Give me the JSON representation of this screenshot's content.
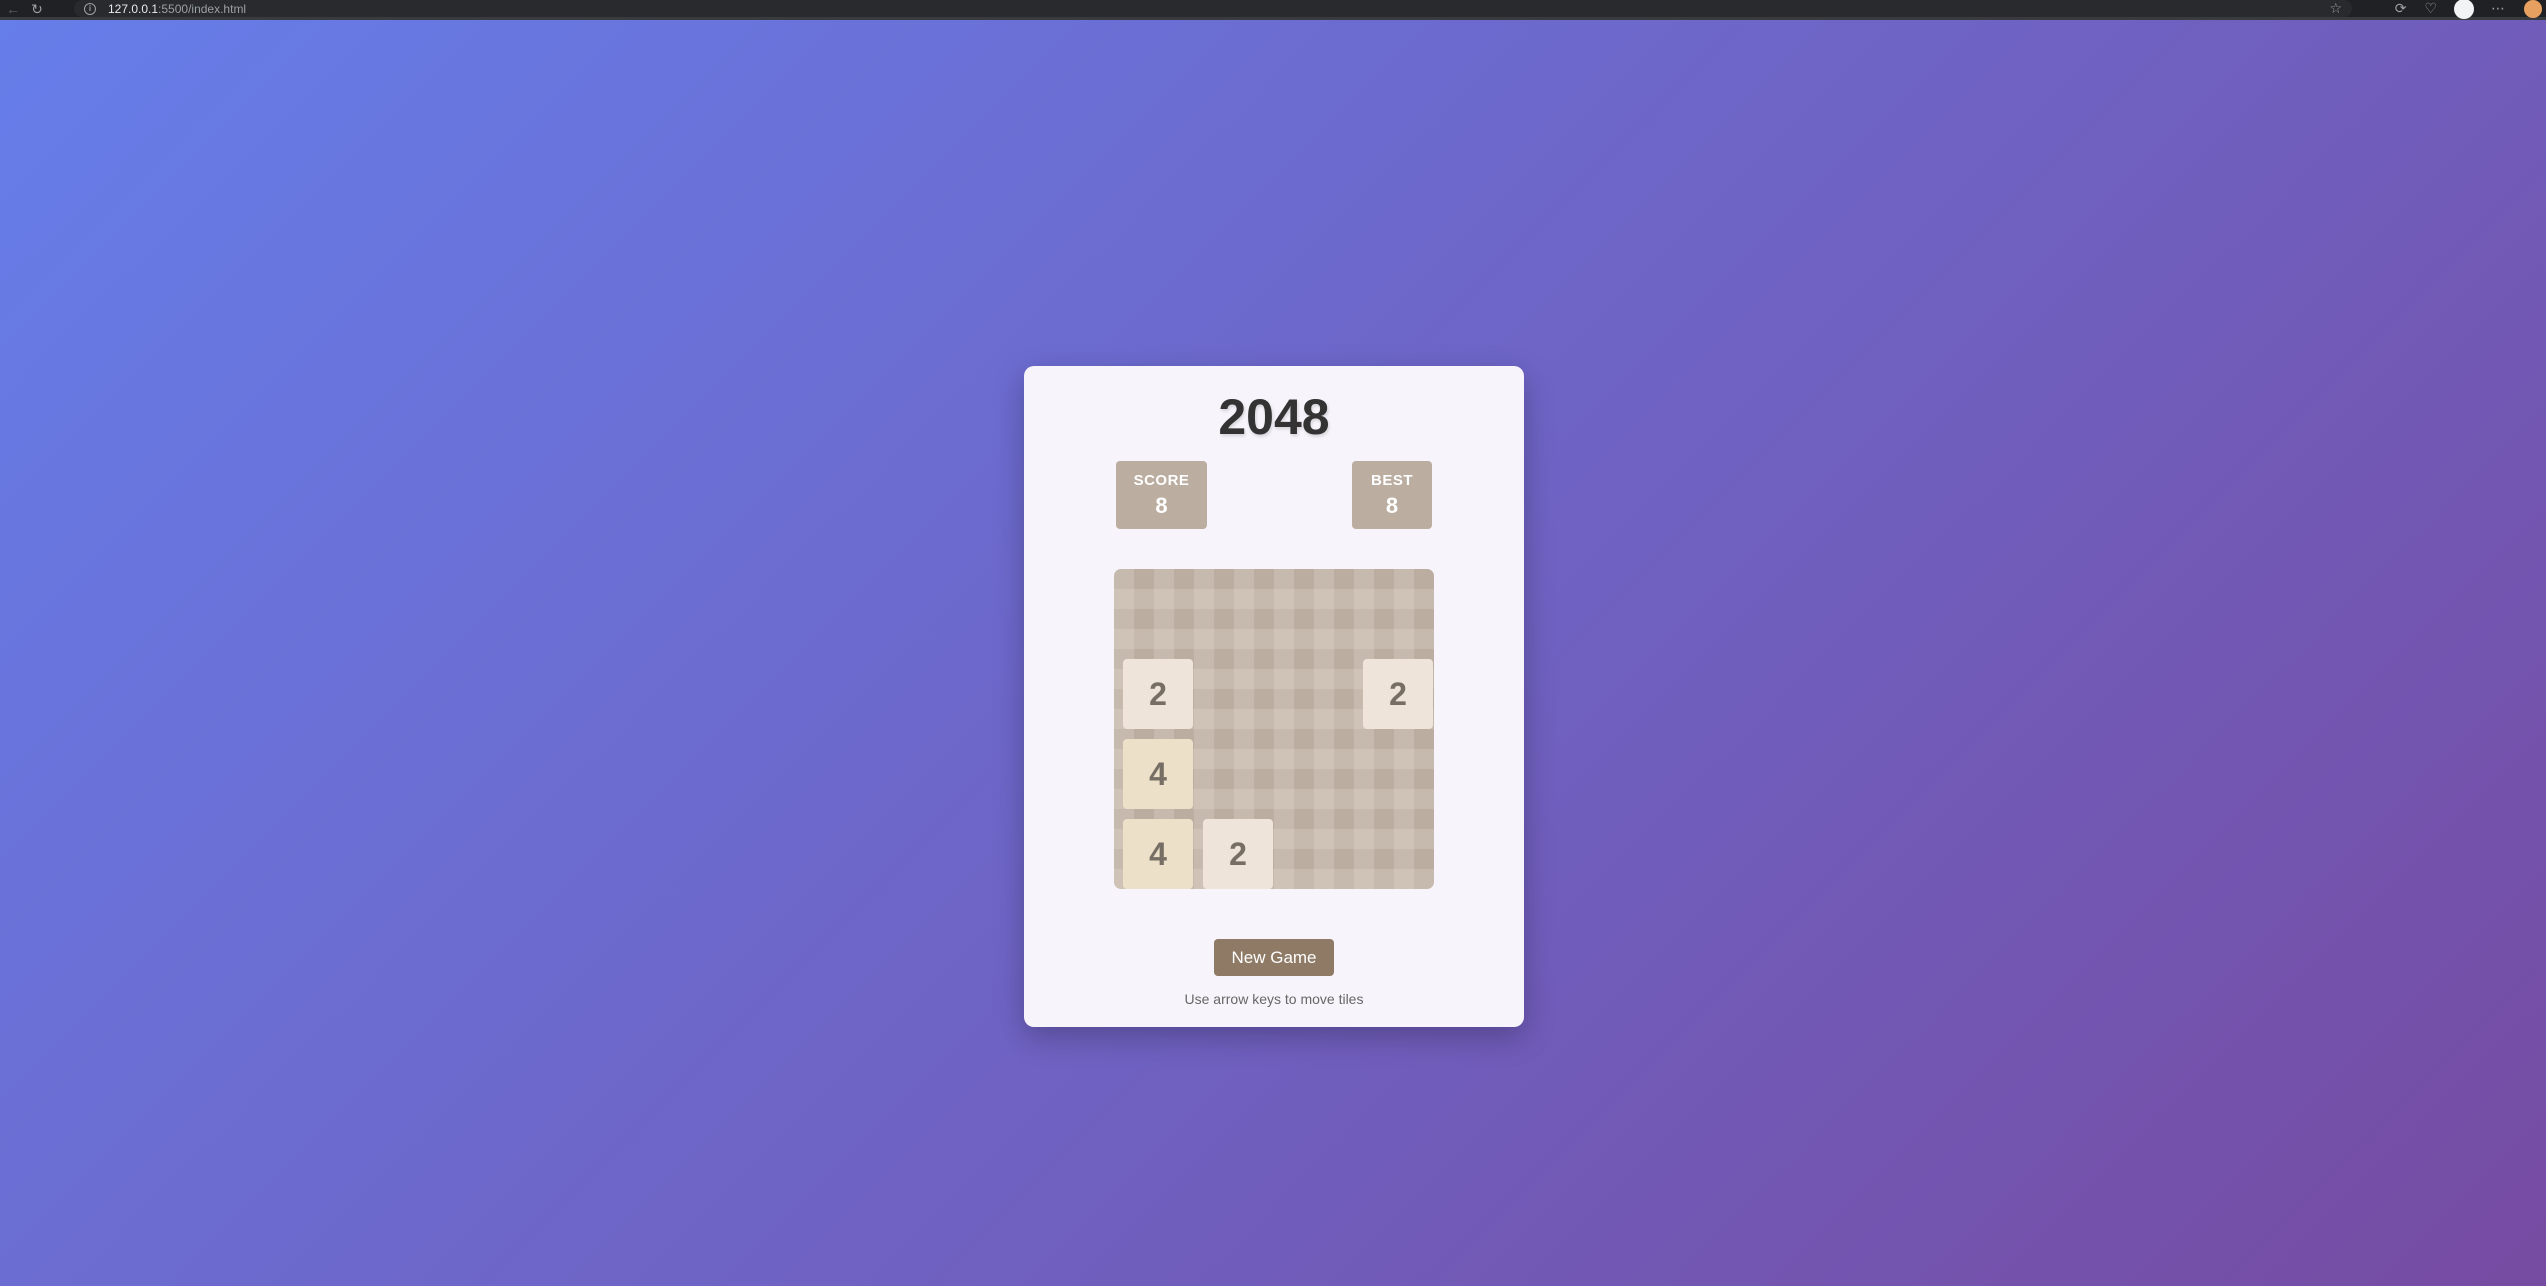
{
  "browser": {
    "url_host": "127.0.0.1",
    "url_rest": ":5500/index.html"
  },
  "game": {
    "title": "2048",
    "score_label": "SCORE",
    "score_value": "8",
    "best_label": "BEST",
    "best_value": "8",
    "tiles": [
      {
        "row": 1,
        "col": 0,
        "value": "2"
      },
      {
        "row": 1,
        "col": 3,
        "value": "2"
      },
      {
        "row": 2,
        "col": 0,
        "value": "4"
      },
      {
        "row": 3,
        "col": 0,
        "value": "4"
      },
      {
        "row": 3,
        "col": 1,
        "value": "2"
      }
    ],
    "new_game_label": "New Game",
    "hint": "Use arrow keys to move tiles"
  }
}
